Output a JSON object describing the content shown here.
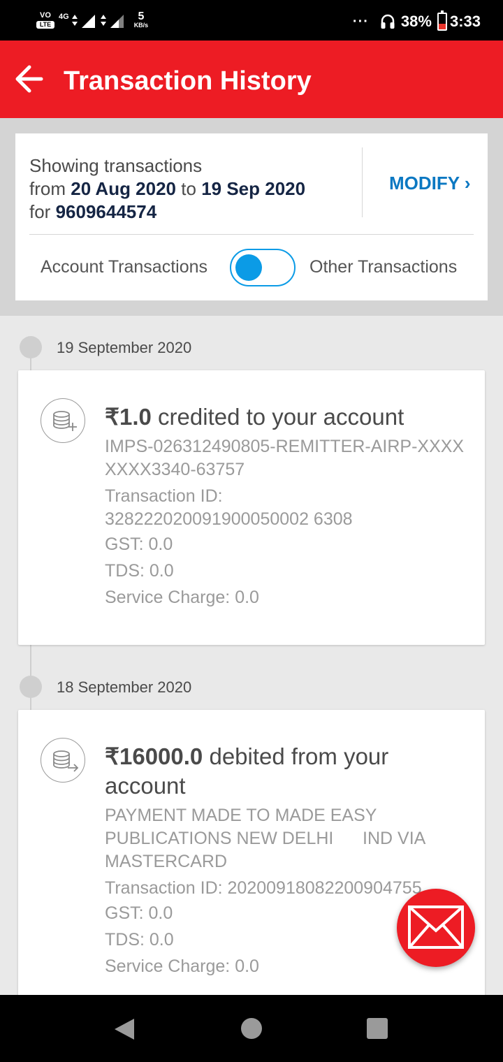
{
  "status_bar": {
    "volte_top": "VO",
    "volte_bottom": "LTE",
    "network": "4G",
    "speed_value": "5",
    "speed_unit": "KB/s",
    "dots": "···",
    "battery": "38%",
    "time": "3:33"
  },
  "app_bar": {
    "title": "Transaction History",
    "back_icon": "arrow-left-icon"
  },
  "filter": {
    "showing_label": "Showing transactions",
    "from_label": "from",
    "from_date": "20 Aug 2020",
    "to_label": "to",
    "to_date": "19 Sep 2020",
    "for_label": "for",
    "account_number": "9609644574",
    "modify_label": "MODIFY ›",
    "toggle_left_label": "Account Transactions",
    "toggle_right_label": "Other Transactions"
  },
  "transactions": [
    {
      "date": "19 September 2020",
      "icon": "coins-plus-icon",
      "amount": "₹1.0",
      "title_rest": " credited to your account",
      "description": "IMPS-026312490805-REMITTER-AIRP-XXXXXXXX3340-63757",
      "txn_id_label": "Transaction ID:",
      "txn_id": "328222020091900050002 6308",
      "gst": "GST: 0.0",
      "tds": "TDS: 0.0",
      "service_charge": "Service Charge: 0.0"
    },
    {
      "date": "18 September 2020",
      "icon": "coins-arrow-icon",
      "amount": "₹16000.0",
      "title_rest": " debited from your account",
      "description": "PAYMENT MADE TO MADE EASY PUBLICATIONS NEW DELHI      IND VIA MASTERCARD",
      "txn_id_full": "Transaction ID: 20200918082200904755",
      "gst": "GST: 0.0",
      "tds": "TDS: 0.0",
      "service_charge": "Service Charge: 0.0"
    }
  ],
  "fab_icon": "mail-icon"
}
